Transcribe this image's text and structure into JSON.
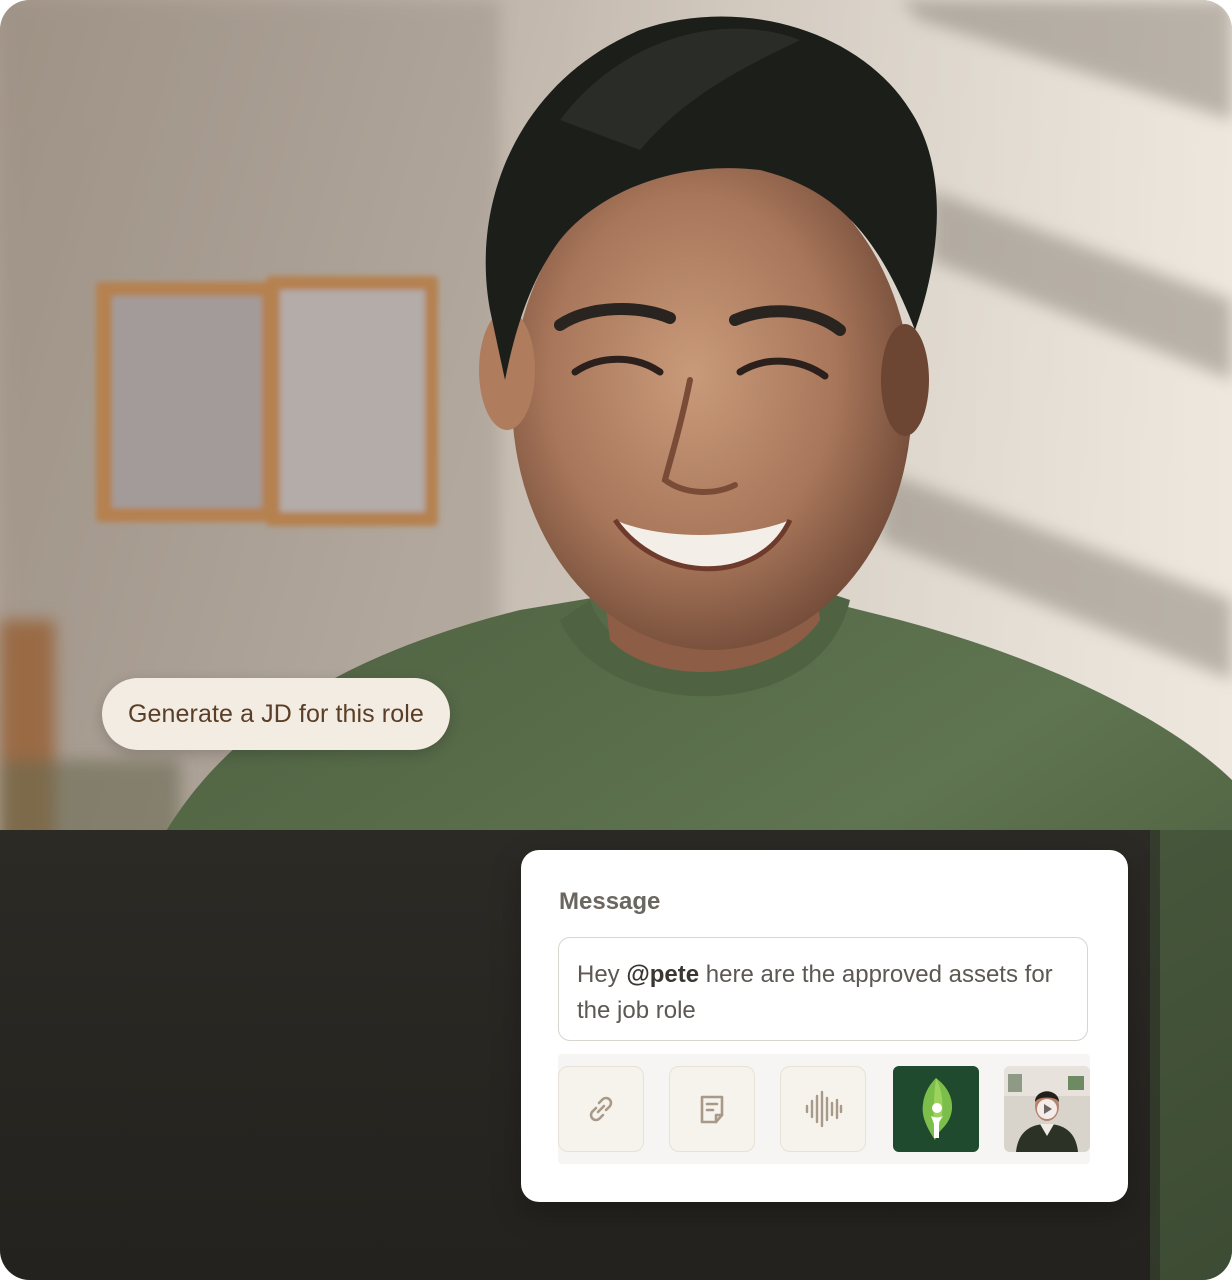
{
  "prompt_chip": {
    "label": "Generate a JD for this role"
  },
  "message_card": {
    "label": "Message",
    "input": {
      "prefix": "Hey ",
      "mention": "@pete",
      "suffix": " here are the approved assets for the job role"
    },
    "attachments": [
      {
        "type": "link",
        "icon": "link-icon"
      },
      {
        "type": "document",
        "icon": "document-icon"
      },
      {
        "type": "audio",
        "icon": "audio-waveform-icon"
      },
      {
        "type": "image",
        "icon": "brand-logo-thumbnail"
      },
      {
        "type": "video",
        "icon": "video-thumbnail"
      }
    ]
  },
  "colors": {
    "chip_background": "#f3ece2",
    "chip_text": "#5a3e27",
    "card_background": "#ffffff",
    "brand_green": "#1f4a2e",
    "sweater_green": "#5a6e4c",
    "icon_tan": "#a89a88"
  }
}
